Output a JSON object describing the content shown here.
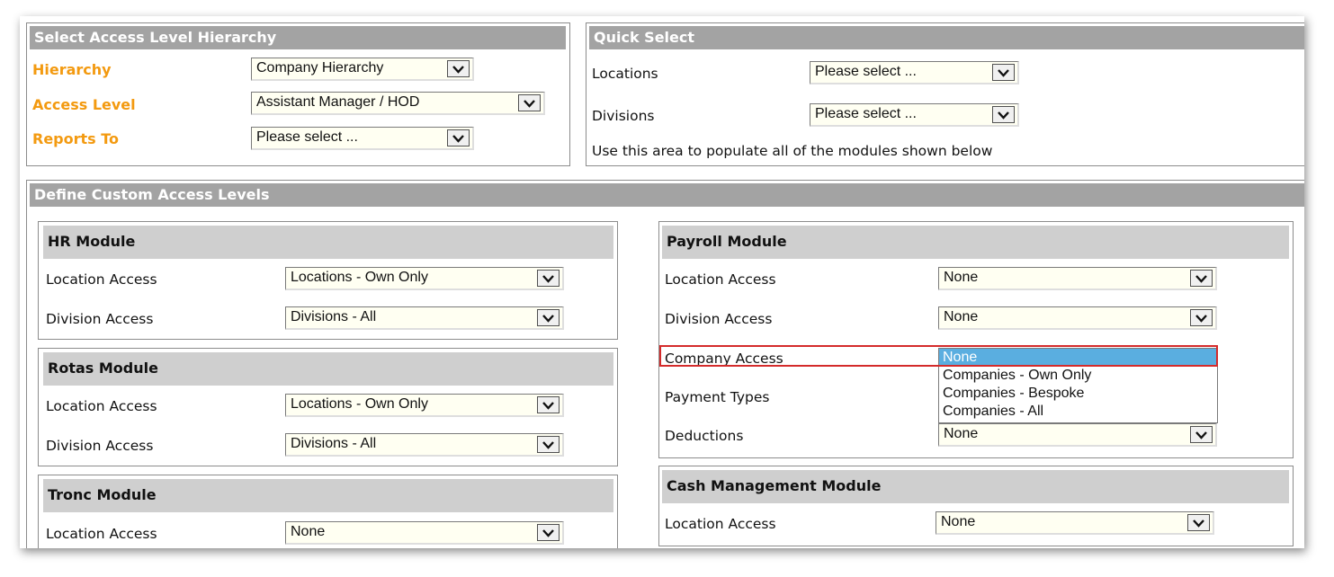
{
  "access_hierarchy": {
    "title": "Select Access Level Hierarchy",
    "hierarchy_label": "Hierarchy",
    "hierarchy_value": "Company Hierarchy",
    "access_level_label": "Access Level",
    "access_level_value": "Assistant Manager / HOD",
    "reports_to_label": "Reports To",
    "reports_to_value": "Please select ..."
  },
  "quick_select": {
    "title": "Quick Select",
    "locations_label": "Locations",
    "locations_value": "Please select ...",
    "divisions_label": "Divisions",
    "divisions_value": "Please select ...",
    "hint": "Use this area to populate all of the modules shown below"
  },
  "custom": {
    "title": "Define Custom Access Levels",
    "hr": {
      "title": "HR Module",
      "location_label": "Location Access",
      "location_value": "Locations - Own Only",
      "division_label": "Division Access",
      "division_value": "Divisions - All"
    },
    "rotas": {
      "title": "Rotas Module",
      "location_label": "Location Access",
      "location_value": "Locations - Own Only",
      "division_label": "Division Access",
      "division_value": "Divisions - All"
    },
    "tronc": {
      "title": "Tronc Module",
      "location_label": "Location Access",
      "location_value": "None"
    },
    "payroll": {
      "title": "Payroll Module",
      "location_label": "Location Access",
      "location_value": "None",
      "division_label": "Division Access",
      "division_value": "None",
      "company_label": "Company Access",
      "company_options": [
        "None",
        "Companies - Own Only",
        "Companies - Bespoke",
        "Companies - All"
      ],
      "payment_types_label": "Payment Types",
      "deductions_label": "Deductions",
      "deductions_value": "None"
    },
    "cash": {
      "title": "Cash Management Module",
      "location_label": "Location Access",
      "location_value": "None"
    }
  },
  "icons": {
    "dropdown_arrow": "chevron-down-icon"
  },
  "colors": {
    "accent_label": "#f39a10",
    "section_header": "#a3a3a3",
    "module_header": "#cfcfcf",
    "highlight": "#d42b2b",
    "selected_option": "#5aaee0"
  }
}
